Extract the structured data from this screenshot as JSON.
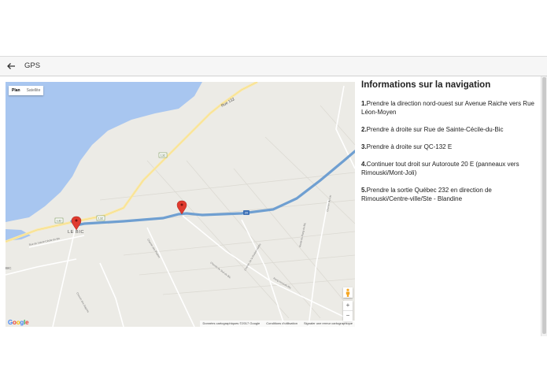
{
  "appbar": {
    "title": "GPS",
    "back_icon": "arrow-left-icon"
  },
  "map": {
    "type_control": {
      "plan": "Plan",
      "satellite": "Satellite",
      "selected": "Plan"
    },
    "labels": {
      "rue132": "Rue 132",
      "route132a": "132",
      "route132b": "132",
      "route132c": "132",
      "route20": "20",
      "town": "LE BIC",
      "bic": "BIC",
      "chemin1": "Chemin des Praires",
      "chemin2": "Chemin du Sud-du-Bic",
      "chemin3": "Chemin de la Rivière-Hâtée",
      "chemin4": "Route du Rang-du-Bic",
      "rue_ste_cecile": "Rue de Sainte-Cécile-du-Bic",
      "rang": "Rang Nord-du-Bic",
      "chemin5": "Chemin des Gagnés",
      "chemin6": "Chemin du Lac"
    },
    "zoom_in": "+",
    "zoom_out": "−",
    "attribution": {
      "data": "Données cartographiques ©2017 Google",
      "terms": "Conditions d'utilisation",
      "report": "Signaler une erreur cartographique"
    },
    "logo": "Google",
    "colors": {
      "water": "#a8c6f0",
      "route": "#6f9fd1",
      "highway": "#fbe9a6",
      "marker": "#e03b2f"
    }
  },
  "navigation": {
    "title": "Informations sur la navigation",
    "steps": [
      {
        "num": "1.",
        "text": "Prendre la direction nord-ouest sur Avenue Raiche vers Rue Léon-Moyen"
      },
      {
        "num": "2.",
        "text": "Prendre à droite sur Rue de Sainte-Cécile-du-Bic"
      },
      {
        "num": "3.",
        "text": "Prendre à droite sur QC-132 E"
      },
      {
        "num": "4.",
        "text": "Continuer tout droit sur Autoroute 20 E (panneaux vers Rimouski/Mont-Joli)"
      },
      {
        "num": "5.",
        "text": "Prendre la sortie Québec 232 en direction de Rimouski/Centre-ville/Ste - Blandine"
      }
    ]
  }
}
